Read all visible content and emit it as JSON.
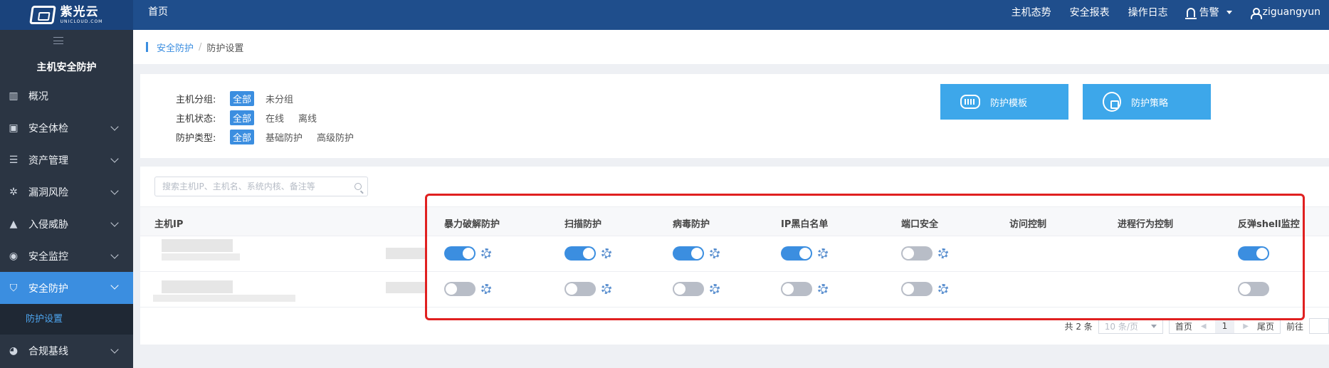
{
  "app": {
    "logo_cn": "紫光云",
    "logo_en": "UNICLOUD.COM",
    "home_link": "首页",
    "top_nav": {
      "host_status": "主机态势",
      "security_report": "安全报表",
      "operation_log": "操作日志",
      "alarm": "告警",
      "username": "ziguangyun"
    }
  },
  "sidebar": {
    "title": "主机安全防护",
    "items": [
      {
        "label": "概况",
        "icon": "chart-icon"
      },
      {
        "label": "安全体检",
        "icon": "checkup-icon"
      },
      {
        "label": "资产管理",
        "icon": "database-icon"
      },
      {
        "label": "漏洞风险",
        "icon": "bug-icon"
      },
      {
        "label": "入侵威胁",
        "icon": "warning-icon"
      },
      {
        "label": "安全监控",
        "icon": "monitor-icon"
      },
      {
        "label": "安全防护",
        "icon": "shield-icon"
      },
      {
        "label": "合规基线",
        "icon": "pie-icon"
      }
    ],
    "active_sub": "防护设置"
  },
  "breadcrumb": {
    "parent": "安全防护",
    "separator": "/",
    "current": "防护设置"
  },
  "filters": {
    "group_label": "主机分组:",
    "group_options": [
      "全部",
      "未分组"
    ],
    "status_label": "主机状态:",
    "status_options": [
      "全部",
      "在线",
      "离线"
    ],
    "type_label": "防护类型:",
    "type_options": [
      "全部",
      "基础防护",
      "高级防护"
    ],
    "template_button": "防护模板",
    "strategy_button": "防护策略"
  },
  "search": {
    "placeholder": "搜索主机IP、主机名、系统内核、备注等"
  },
  "table": {
    "columns": [
      "主机IP",
      "暴力破解防护",
      "扫描防护",
      "病毒防护",
      "IP黑白名单",
      "端口安全",
      "访问控制",
      "进程行为控制",
      "反弹shell监控"
    ],
    "rows": [
      {
        "switches": [
          true,
          true,
          true,
          true,
          false,
          null,
          null,
          true
        ]
      },
      {
        "switches": [
          false,
          false,
          false,
          false,
          false,
          null,
          null,
          false
        ]
      }
    ]
  },
  "pagination": {
    "total": "共 2 条",
    "page_size": "10 条/页",
    "first": "首页",
    "current_page": "1",
    "last": "尾页",
    "goto": "前往"
  },
  "colors": {
    "topbar": "#1f4e8c",
    "sidebar": "#2b3543",
    "accent": "#3b8ee0",
    "annotation": "#e02020"
  }
}
